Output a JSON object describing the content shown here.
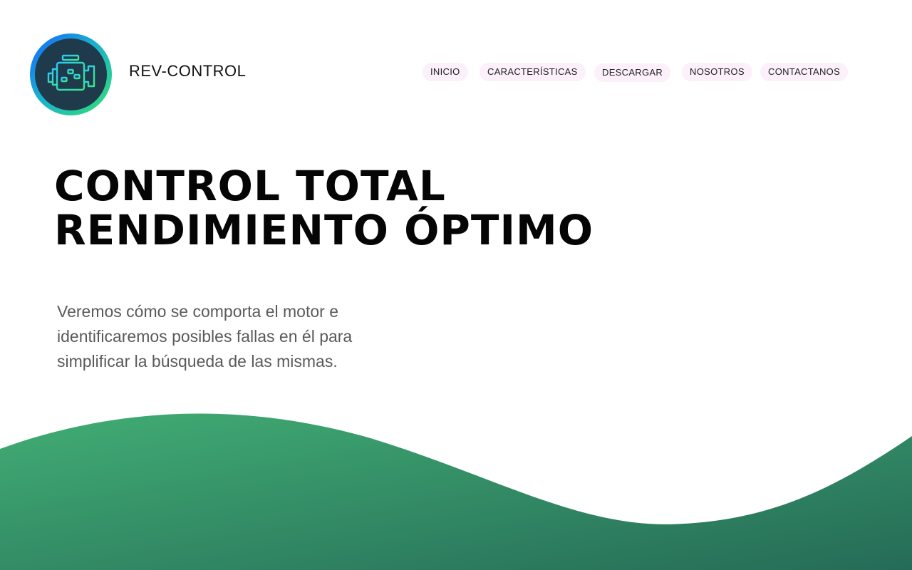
{
  "header": {
    "brand": "REV-CONTROL",
    "logo_icon": "engine-control-icon"
  },
  "nav": {
    "items": [
      {
        "label": "INICIO"
      },
      {
        "label": "CARACTERÍSTICAS"
      },
      {
        "label": "DESCARGAR"
      },
      {
        "label": "NOSOTROS"
      },
      {
        "label": "CONTACTANOS"
      }
    ]
  },
  "hero": {
    "title_line1": "CONTROL TOTAL",
    "title_line2": "RENDIMIENTO ÓPTIMO",
    "description": "Veremos cómo se comporta el motor e identificaremos posibles fallas en él para simplificar la búsqueda de las mismas."
  },
  "colors": {
    "wave_start": "#41ad74",
    "wave_end": "#256b57",
    "nav_pill_bg": "#fcf0fb",
    "logo_ring_start": "#1565ff",
    "logo_ring_end": "#35e070"
  }
}
